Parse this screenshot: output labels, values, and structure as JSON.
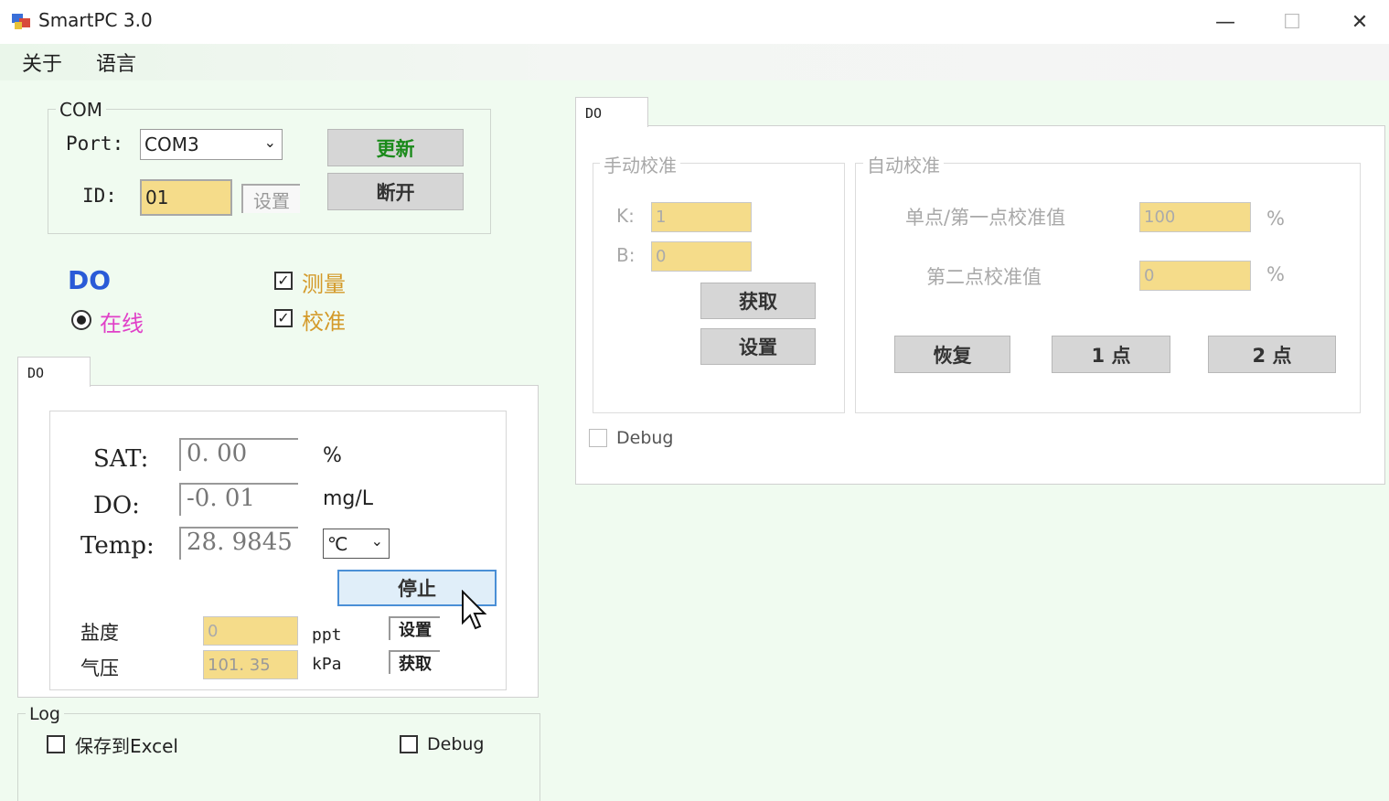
{
  "window": {
    "title": "SmartPC 3.0",
    "minimize": "—",
    "maximize": "☐",
    "close": "✕"
  },
  "menu": {
    "about": "关于",
    "language": "语言"
  },
  "com": {
    "legend": "COM",
    "port_label": "Port:",
    "port_value": "COM3",
    "id_label": "ID:",
    "id_value": "01",
    "set_label": "设置",
    "update_label": "更新",
    "disconnect_label": "断开"
  },
  "status": {
    "device": "DO",
    "online": "在线",
    "measure": "测量",
    "calibrate": "校准",
    "colors": {
      "device": "#2a5bd7",
      "online": "#e040c8",
      "measure": "#d49a2a"
    }
  },
  "left_tab": {
    "label": "DO"
  },
  "readings": {
    "sat_label": "SAT:",
    "sat_value": "0. 00",
    "sat_unit": "%",
    "do_label": "DO:",
    "do_value": "-0. 01",
    "do_unit": "mg/L",
    "temp_label": "Temp:",
    "temp_value": "28. 9845",
    "temp_unit_select": "℃",
    "stop_label": "停止",
    "salinity_label": "盐度",
    "salinity_value": "0",
    "salinity_unit": "ppt",
    "salinity_set": "设置",
    "pressure_label": "气压",
    "pressure_value": "101. 35",
    "pressure_unit": "kPa",
    "pressure_get": "获取"
  },
  "log": {
    "legend": "Log",
    "save_excel": "保存到Excel",
    "debug": "Debug"
  },
  "right_tab": {
    "label": "DO"
  },
  "manual": {
    "legend": "手动校准",
    "k_label": "K:",
    "k_value": "1",
    "b_label": "B:",
    "b_value": "0",
    "get_label": "获取",
    "set_label": "设置"
  },
  "auto": {
    "legend": "自动校准",
    "first_label": "单点/第一点校准值",
    "first_value": "100",
    "first_unit": "%",
    "second_label": "第二点校准值",
    "second_value": "0",
    "second_unit": "%",
    "restore_label": "恢复",
    "one_point_label": "1 点",
    "two_point_label": "2 点"
  },
  "right_debug": {
    "label": "Debug"
  }
}
